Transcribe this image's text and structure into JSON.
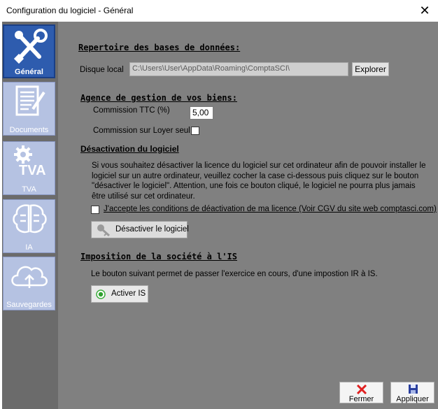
{
  "window": {
    "title": "Configuration du logiciel - Général",
    "close_icon": "close-icon"
  },
  "sidebar": {
    "items": [
      {
        "label": "Général",
        "icon": "tools-icon",
        "active": true
      },
      {
        "label": "Documents",
        "icon": "document-icon",
        "active": false
      },
      {
        "label": "TVA",
        "icon": "gear-icon",
        "badge": "TVA",
        "active": false
      },
      {
        "label": "IA",
        "icon": "brain-icon",
        "active": false
      },
      {
        "label": "Sauvegardes",
        "icon": "cloud-upload-icon",
        "active": false
      }
    ]
  },
  "database": {
    "heading": "Repertoire des bases de données:",
    "label": "Disque local",
    "path": "C:\\Users\\User\\AppData\\Roaming\\ComptaSCI\\",
    "browse_label": "Explorer"
  },
  "agency": {
    "heading": "Agence de gestion de vos biens:",
    "commission_label": "Commission TTC (%)",
    "commission_value": "5,00",
    "rent_only_label": "Commission sur Loyer seul",
    "rent_only_checked": false
  },
  "deactivation": {
    "heading": "Désactivation du logiciel",
    "line1": "Si vous souhaitez désactiver la licence du logiciel sur cet ordinateur afin de pouvoir installer le",
    "line2": "logiciel sur un autre ordinateur, veuillez cocher la case ci-dessous puis cliquez sur le bouton",
    "line3": "\"désactiver le logiciel\". Attention, une fois ce bouton cliqué, le logiciel ne pourra plus jamais",
    "line4": "être utilisé sur cet ordinateur.",
    "accept_label": "J'accepte les conditions de déactivation de ma licence (Voir CGV du site web comptasci.com)",
    "accept_checked": false,
    "button_label": "Désactiver le logiciel"
  },
  "tax": {
    "heading": "Imposition de la société à l'IS",
    "description": "Le bouton suivant permet de passer l'exercice en cours, d'une impostion IR à IS.",
    "button_label": "Activer IS"
  },
  "footer": {
    "close_label": "Fermer",
    "apply_label": "Appliquer"
  },
  "colors": {
    "content_bg": "#808080",
    "sidebar_bg": "#6b6b6b",
    "active_nav": "#2e5cae",
    "inactive_nav": "#b5c2e2"
  }
}
